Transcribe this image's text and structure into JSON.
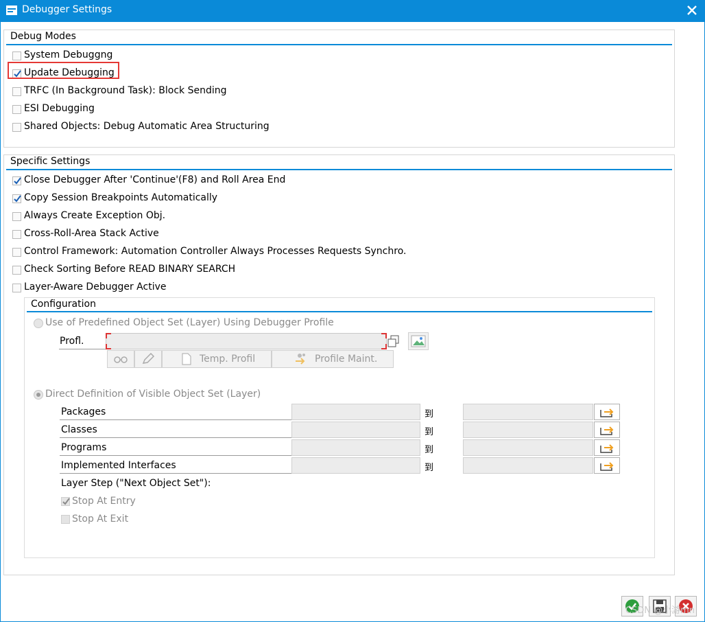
{
  "window": {
    "title": "Debugger Settings"
  },
  "debug_modes": {
    "title": "Debug Modes",
    "items": [
      {
        "label": "System Debuggng",
        "checked": false
      },
      {
        "label": "Update Debugging",
        "checked": true
      },
      {
        "label": "TRFC (In Background Task): Block Sending",
        "checked": false
      },
      {
        "label": "ESI Debugging",
        "checked": false
      },
      {
        "label": "Shared Objects: Debug Automatic Area Structuring",
        "checked": false
      }
    ]
  },
  "specific_settings": {
    "title": "Specific Settings",
    "items": [
      {
        "label": "Close Debugger After 'Continue'(F8) and Roll Area End",
        "checked": true
      },
      {
        "label": "Copy Session Breakpoints Automatically",
        "checked": true
      },
      {
        "label": "Always Create Exception Obj.",
        "checked": false
      },
      {
        "label": "Cross-Roll-Area Stack Active",
        "checked": false
      },
      {
        "label": "Control Framework: Automation Controller Always Processes Requests Synchro.",
        "checked": false
      },
      {
        "label": "Check Sorting Before READ BINARY SEARCH",
        "checked": false
      },
      {
        "label": "Layer-Aware Debugger Active",
        "checked": false
      }
    ]
  },
  "configuration": {
    "title": "Configuration",
    "predefined_option": "Use of Predefined Object Set (Layer) Using Debugger Profile",
    "profile_label": "Profl.",
    "profile_value": "",
    "temp_profil_label": "Temp. Profil",
    "profile_maint_label": "Profile Maint.",
    "direct_option": "Direct Definition of Visible Object Set (Layer)",
    "to_label": "到",
    "ranges": [
      {
        "label": "Packages",
        "from": "",
        "to": ""
      },
      {
        "label": "Classes",
        "from": "",
        "to": ""
      },
      {
        "label": "Programs",
        "from": "",
        "to": ""
      },
      {
        "label": "Implemented Interfaces",
        "from": "",
        "to": ""
      }
    ],
    "layer_step_label": "Layer Step (\"Next Object Set\"):",
    "stop_at_entry": {
      "label": "Stop At Entry",
      "checked": true
    },
    "stop_at_exit": {
      "label": "Stop At Exit",
      "checked": false
    }
  },
  "footer": {
    "watermark": "CSDN @小游mn"
  },
  "colors": {
    "accent": "#0a8ad8",
    "highlight_box": "#e53935",
    "ok_green": "#2e9e3e",
    "cancel_red": "#d32f2f"
  }
}
